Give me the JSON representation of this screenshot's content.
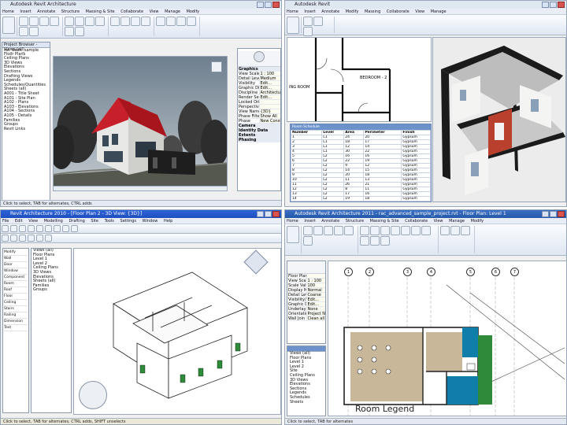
{
  "pane1": {
    "title": "Autodesk Revit Architecture",
    "tabs": [
      "Home",
      "Insert",
      "Annotate",
      "Structure",
      "Massing & Site",
      "Collaborate",
      "View",
      "Manage",
      "Modify"
    ],
    "browser_title": "Project Browser - rac_basic_sample",
    "browser_items": [
      "Views (all)",
      "Floor Plans",
      "Ceiling Plans",
      "3D Views",
      "Elevations",
      "Sections",
      "Drafting Views",
      "Legends",
      "Schedules/Quantities",
      "Sheets (all)",
      "A001 - Title Sheet",
      "A101 - Site Plan",
      "A102 - Plans",
      "A103 - Elevations",
      "A104 - Sections",
      "A105 - Details",
      "Families",
      "Groups",
      "Revit Links"
    ],
    "props_sections": [
      "Graphics",
      "Camera",
      "Identity Data",
      "Extents",
      "Phasing"
    ],
    "props_rows": [
      [
        "View Scale",
        "1 : 100"
      ],
      [
        "Detail Level",
        "Medium"
      ],
      [
        "Visibility",
        "Edit..."
      ],
      [
        "Graphic Display",
        "Edit..."
      ],
      [
        "Discipline",
        "Architectural"
      ],
      [
        "Render Settings",
        "Edit..."
      ],
      [
        "Locked Orient",
        ""
      ],
      [
        "Perspective",
        ""
      ],
      [
        "View Name",
        "{3D}"
      ],
      [
        "Phase Filter",
        "Show All"
      ],
      [
        "Phase",
        "New Construction"
      ]
    ],
    "status": "Click to select, TAB for alternates, CTRL adds"
  },
  "pane2": {
    "title": "Autodesk Revit",
    "tabs": [
      "Home",
      "Insert",
      "Annotate",
      "Modify",
      "Massing",
      "Collaborate",
      "View",
      "Manage"
    ],
    "room_label": "BEDROOM - 2",
    "room_label2": "ING ROOM",
    "schedule_title": "Room Schedule",
    "schedule_cols": [
      "Number",
      "Level",
      "Area",
      "Perimeter",
      "Finish"
    ],
    "schedule_rows": [
      [
        "1",
        "L1",
        "24",
        "20",
        "Gypsum"
      ],
      [
        "2",
        "L1",
        "18",
        "17",
        "Gypsum"
      ],
      [
        "3",
        "L1",
        "12",
        "14",
        "Gypsum"
      ],
      [
        "4",
        "L1",
        "30",
        "22",
        "Gypsum"
      ],
      [
        "5",
        "L2",
        "16",
        "16",
        "Gypsum"
      ],
      [
        "6",
        "L2",
        "22",
        "19",
        "Gypsum"
      ],
      [
        "7",
        "L2",
        "9",
        "12",
        "Gypsum"
      ],
      [
        "8",
        "L2",
        "14",
        "15",
        "Gypsum"
      ],
      [
        "9",
        "L2",
        "20",
        "18",
        "Gypsum"
      ],
      [
        "10",
        "L2",
        "11",
        "13",
        "Gypsum"
      ],
      [
        "11",
        "L2",
        "26",
        "21",
        "Gypsum"
      ],
      [
        "12",
        "L2",
        "8",
        "11",
        "Gypsum"
      ],
      [
        "13",
        "L2",
        "17",
        "16",
        "Gypsum"
      ],
      [
        "14",
        "L2",
        "19",
        "18",
        "Gypsum"
      ],
      [
        "15",
        "L2",
        "10",
        "13",
        "Gypsum"
      ]
    ]
  },
  "pane3": {
    "title": "Revit Architecture 2010 - [Floor Plan 2 - 3D View: {3D}]",
    "menus": [
      "File",
      "Edit",
      "View",
      "Modelling",
      "Drafting",
      "Site",
      "Tools",
      "Settings",
      "Window",
      "Help"
    ],
    "basics": [
      "Modify",
      "Wall",
      "Door",
      "Window",
      "Component",
      "Room",
      "Roof",
      "Floor",
      "Ceiling",
      "Stairs",
      "Railing",
      "Dimension",
      "Text"
    ],
    "browser_items": [
      "Views (all)",
      "Floor Plans",
      "Level 1",
      "Level 2",
      "Ceiling Plans",
      "3D Views",
      "Elevations",
      "Sheets (all)",
      "Families",
      "Groups"
    ],
    "status": "Click to select, TAB for alternates, CTRL adds, SHIFT unselects"
  },
  "pane4": {
    "title": "Autodesk Revit Architecture 2011 - rac_advanced_sample_project.rvt - Floor Plan: Level 1",
    "tabs": [
      "Home",
      "Insert",
      "Annotate",
      "Structure",
      "Massing & Site",
      "Collaborate",
      "View",
      "Manage",
      "Modify"
    ],
    "grid_bubbles": [
      "1",
      "2",
      "3",
      "4",
      "5",
      "6",
      "7"
    ],
    "legend": "Room Legend",
    "props_rows": [
      [
        "Floor Plan",
        ""
      ],
      [
        "View Scale",
        "1 : 100"
      ],
      [
        "Scale Value",
        "100"
      ],
      [
        "Display Model",
        "Normal"
      ],
      [
        "Detail Level",
        "Coarse"
      ],
      [
        "Visibility/Gr",
        "Edit..."
      ],
      [
        "Graphic Disp",
        "Edit..."
      ],
      [
        "Underlay",
        "None"
      ],
      [
        "Orientation",
        "Project North"
      ],
      [
        "Wall Join",
        "Clean all"
      ]
    ],
    "browser_items": [
      "Views (all)",
      "Floor Plans",
      "Level 1",
      "Level 2",
      "Site",
      "Ceiling Plans",
      "3D Views",
      "Elevations",
      "Sections",
      "Legends",
      "Schedules",
      "Sheets"
    ],
    "status": "Click to select, TAB for alternates"
  },
  "colors": {
    "roof_red": "#c8202a",
    "sky": "#8a9aa8",
    "plan_blue": "#0f7ea8",
    "plan_green": "#2f8a3a",
    "plan_tan": "#c9b79a"
  }
}
